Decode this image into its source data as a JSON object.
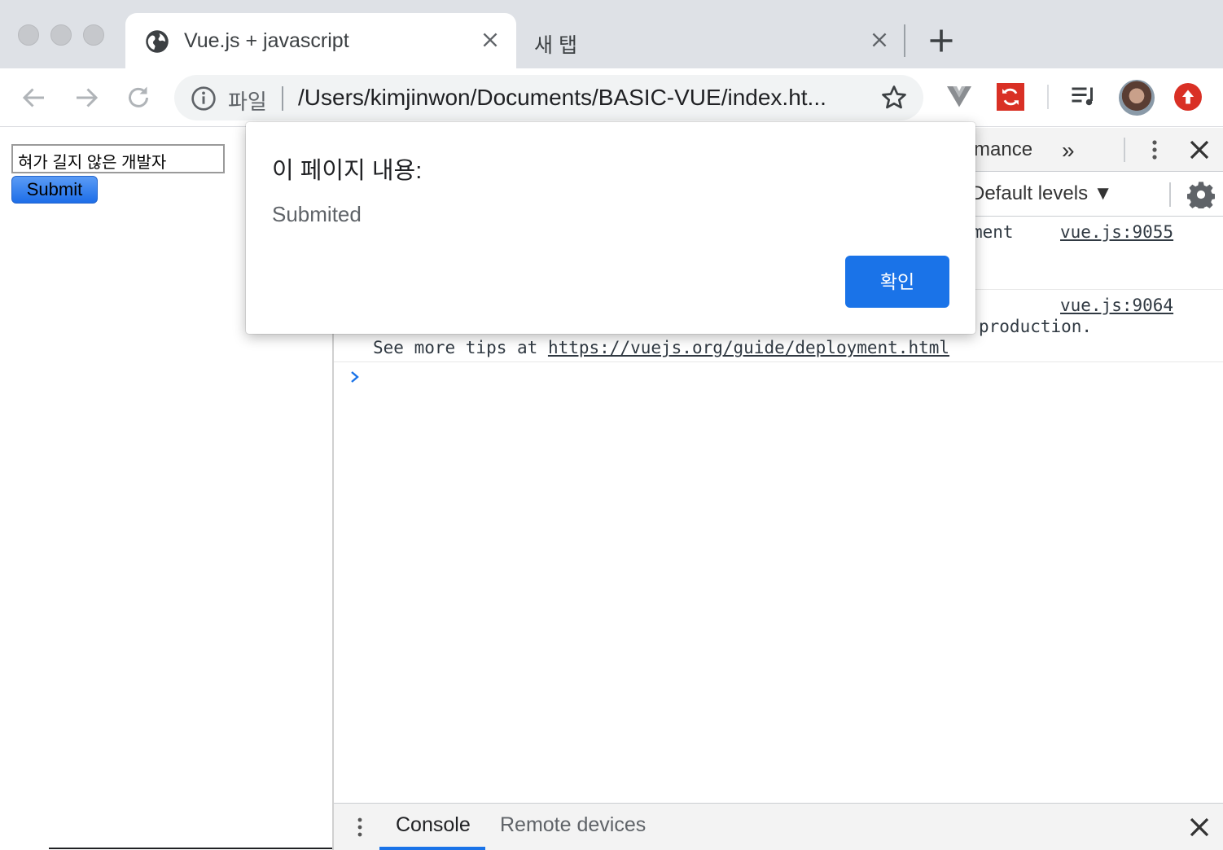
{
  "tabs": [
    {
      "title": "Vue.js + javascript",
      "icon": "globe-icon",
      "active": true
    },
    {
      "title": "새 탭",
      "icon": "",
      "active": false
    }
  ],
  "omnibox": {
    "scheme_label": "파일",
    "url": "/Users/kimjinwon/Documents/BASIC-VUE/index.ht..."
  },
  "page": {
    "input_value": "혀가 길지 않은 개발자",
    "submit_label": "Submit"
  },
  "devtools": {
    "panel_tab_partial": "mance",
    "overflow_label": "»",
    "levels_label": "Default levels ▼",
    "logs": [
      {
        "text": "ment",
        "source": "vue.js:9055"
      },
      {
        "text": "production.",
        "source": "vue.js:9064",
        "continuation_prefix": "See more tips at ",
        "link": "https://vuejs.org/guide/deployment.html"
      }
    ],
    "drawer_tabs": [
      "Console",
      "Remote devices"
    ],
    "accent": "#1a73e8"
  },
  "dialog": {
    "title": "이 페이지 내용:",
    "message": "Submited",
    "ok_label": "확인"
  }
}
